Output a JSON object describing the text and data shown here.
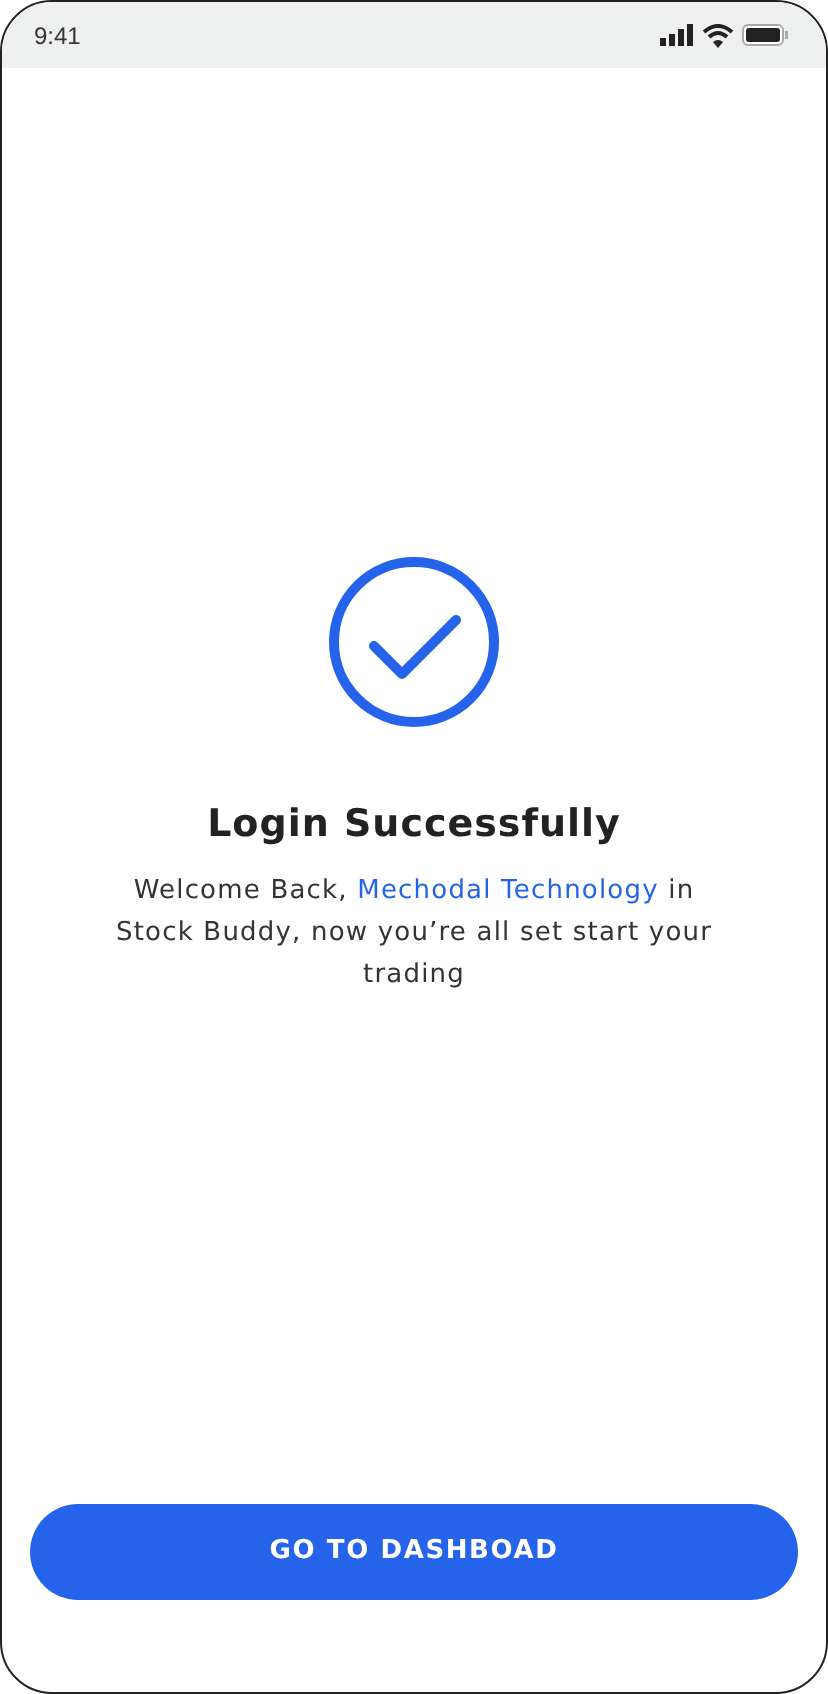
{
  "status_bar": {
    "time": "9:41"
  },
  "title": "Login Successfully",
  "message": {
    "before": "Welcome Back, ",
    "highlight": "Mechodal Technology",
    "after": " in Stock Buddy, now you’re all set start your trading"
  },
  "button": {
    "label": "GO TO DASHBOAD"
  }
}
